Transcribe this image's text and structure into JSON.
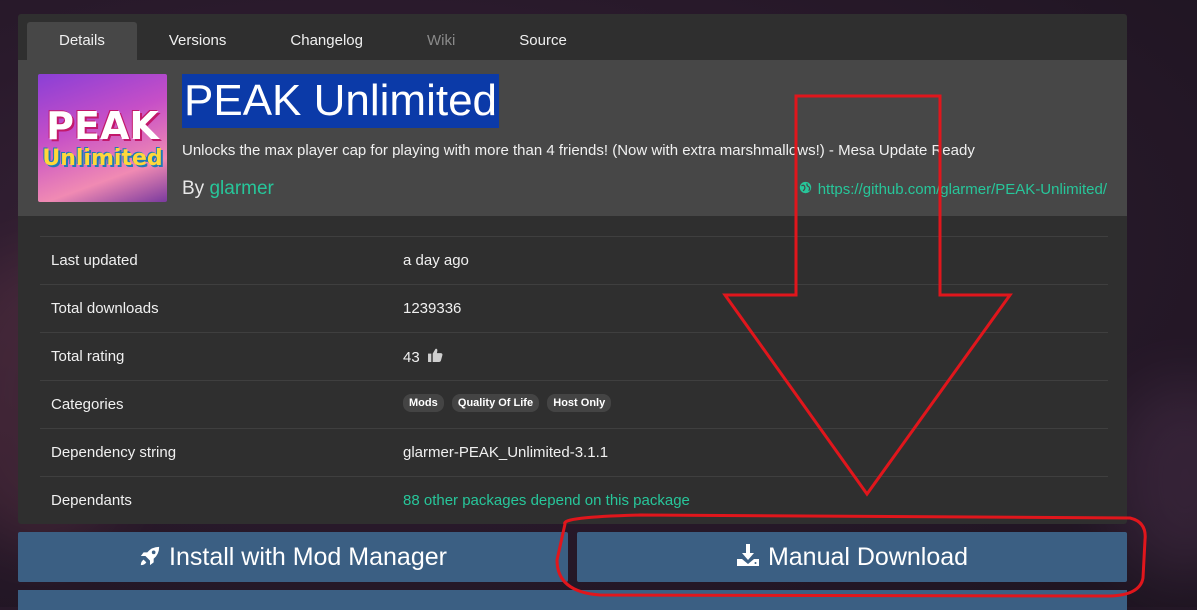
{
  "tabs": [
    {
      "label": "Details",
      "active": true
    },
    {
      "label": "Versions",
      "active": false
    },
    {
      "label": "Changelog",
      "active": false
    },
    {
      "label": "Wiki",
      "active": false,
      "disabled": true
    },
    {
      "label": "Source",
      "active": false
    }
  ],
  "package": {
    "logo_text_top": "PEAK",
    "logo_text_bottom": "Unlimited",
    "title": "PEAK Unlimited",
    "description": "Unlocks the max player cap for playing with more than 4 friends! (Now with extra marshmallows!) - Mesa Update Ready",
    "by_label": "By",
    "author": "glarmer",
    "repo_url": "https://github.com/glarmer/PEAK-Unlimited/",
    "repo_icon": "globe-icon"
  },
  "info_rows": {
    "last_updated": {
      "label": "Last updated",
      "value": "a day ago"
    },
    "total_downloads": {
      "label": "Total downloads",
      "value": "1239336"
    },
    "total_rating": {
      "label": "Total rating",
      "value": "43",
      "icon": "thumbs-up-icon"
    },
    "categories": {
      "label": "Categories",
      "values": [
        "Mods",
        "Quality Of Life",
        "Host Only"
      ]
    },
    "dependency_string": {
      "label": "Dependency string",
      "value": "glarmer-PEAK_Unlimited-3.1.1"
    },
    "dependants": {
      "label": "Dependants",
      "value": "88 other packages depend on this package"
    }
  },
  "buttons": {
    "install": {
      "label": "Install with Mod Manager",
      "icon": "rocket-icon"
    },
    "manual": {
      "label": "Manual Download",
      "icon": "download-icon"
    }
  },
  "colors": {
    "accent_green": "#27c69a",
    "button_blue": "#3b5f83",
    "annotation_red": "#e0161c",
    "title_highlight": "#0b3aa8"
  }
}
